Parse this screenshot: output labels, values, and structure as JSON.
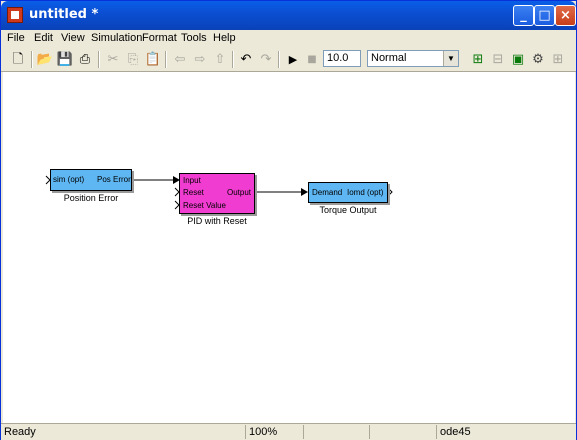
{
  "window": {
    "title": "untitled *"
  },
  "menu": [
    "File",
    "Edit",
    "View",
    "Simulation",
    "Format",
    "Tools",
    "Help"
  ],
  "toolbar": {
    "stop_time": "10.0",
    "sim_mode": "Normal",
    "icons": [
      "new-icon",
      "open-icon",
      "save-icon",
      "print-icon",
      "cut-icon",
      "copy-icon",
      "paste-icon",
      "back-icon",
      "forward-icon",
      "up-icon",
      "undo-icon",
      "redo-icon",
      "start-icon",
      "stop-icon",
      "library-browser-icon",
      "toggle-model-browser-icon",
      "model-explorer-icon",
      "debug-icon"
    ]
  },
  "blocks": {
    "inport": {
      "port_in": "sim (opt)",
      "port_out": "Pos Error",
      "label": "Position Error"
    },
    "pid": {
      "port_in_1": "Input",
      "port_in_2": "Reset",
      "port_in_3": "Reset Value",
      "port_out": "Output",
      "label": "PID with Reset"
    },
    "outport": {
      "port_in": "Demand",
      "port_out": "Iomd (opt)",
      "label": "Torque Output"
    }
  },
  "status": {
    "text": "Ready",
    "zoom": "100%",
    "solver": "ode45"
  },
  "colors": {
    "io_block": "#5eb6f2",
    "pid_block": "#f03cd0",
    "titlebar": "#0b4fd3"
  }
}
